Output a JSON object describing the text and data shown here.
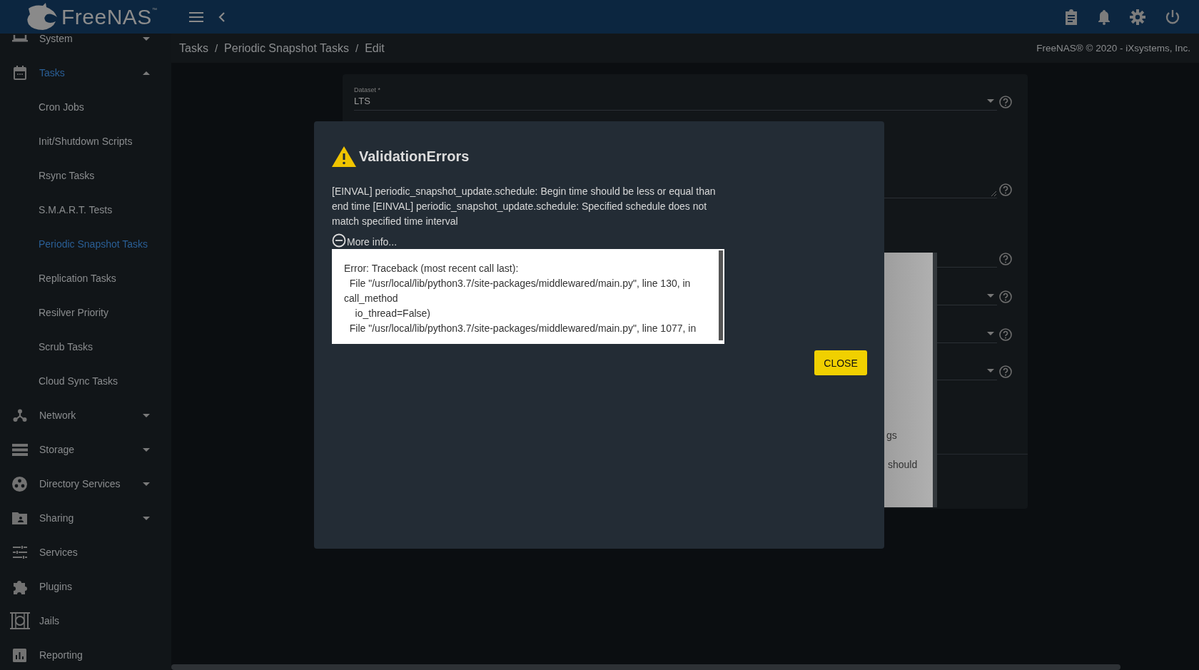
{
  "header": {
    "logo": "FreeNAS",
    "trademark": "™"
  },
  "sidebar": {
    "items": [
      {
        "label": "System",
        "kind": "group",
        "expanded": false,
        "selected": false
      },
      {
        "label": "Tasks",
        "kind": "group",
        "expanded": true,
        "selected": true,
        "children": [
          {
            "label": "Cron Jobs",
            "selected": false
          },
          {
            "label": "Init/Shutdown Scripts",
            "selected": false
          },
          {
            "label": "Rsync Tasks",
            "selected": false
          },
          {
            "label": "S.M.A.R.T. Tests",
            "selected": false
          },
          {
            "label": "Periodic Snapshot Tasks",
            "selected": true
          },
          {
            "label": "Replication Tasks",
            "selected": false
          },
          {
            "label": "Resilver Priority",
            "selected": false
          },
          {
            "label": "Scrub Tasks",
            "selected": false
          },
          {
            "label": "Cloud Sync Tasks",
            "selected": false
          }
        ]
      },
      {
        "label": "Network",
        "kind": "group",
        "expanded": false,
        "selected": false
      },
      {
        "label": "Storage",
        "kind": "group",
        "expanded": false,
        "selected": false
      },
      {
        "label": "Directory Services",
        "kind": "group",
        "expanded": false,
        "selected": false
      },
      {
        "label": "Sharing",
        "kind": "group",
        "expanded": false,
        "selected": false
      },
      {
        "label": "Services",
        "kind": "link",
        "selected": false
      },
      {
        "label": "Plugins",
        "kind": "link",
        "selected": false
      },
      {
        "label": "Jails",
        "kind": "link",
        "selected": false
      },
      {
        "label": "Reporting",
        "kind": "link",
        "selected": false
      }
    ]
  },
  "breadcrumb": {
    "separator": "/",
    "items": [
      "Tasks",
      "Periodic Snapshot Tasks",
      "Edit"
    ]
  },
  "copyright": "FreeNAS® © 2020 - iXsystems, Inc.",
  "form": {
    "fields": [
      {
        "kind": "select",
        "label": "Dataset *",
        "value": "LTS"
      },
      {
        "kind": "textarea"
      },
      {
        "kind": "input"
      },
      {
        "kind": "select"
      },
      {
        "kind": "select"
      },
      {
        "kind": "select"
      }
    ]
  },
  "tooltip": {
    "lines": [
      "gs",
      "should"
    ]
  },
  "dialog": {
    "title": "ValidationErrors",
    "message": "[EINVAL] periodic_snapshot_update.schedule: Begin time should be less or equal than end time [EINVAL] periodic_snapshot_update.schedule: Specified schedule does not match specified time interval",
    "more_info": {
      "label": "More info...",
      "expanded": true
    },
    "details": [
      "Error: Traceback (most recent call last):",
      "  File \"/usr/local/lib/python3.7/site-packages/middlewared/main.py\", line 130, in call_method",
      "    io_thread=False)",
      "  File \"/usr/local/lib/python3.7/site-packages/middlewared/main.py\", line 1077, in"
    ],
    "close_button": "CLOSE"
  }
}
